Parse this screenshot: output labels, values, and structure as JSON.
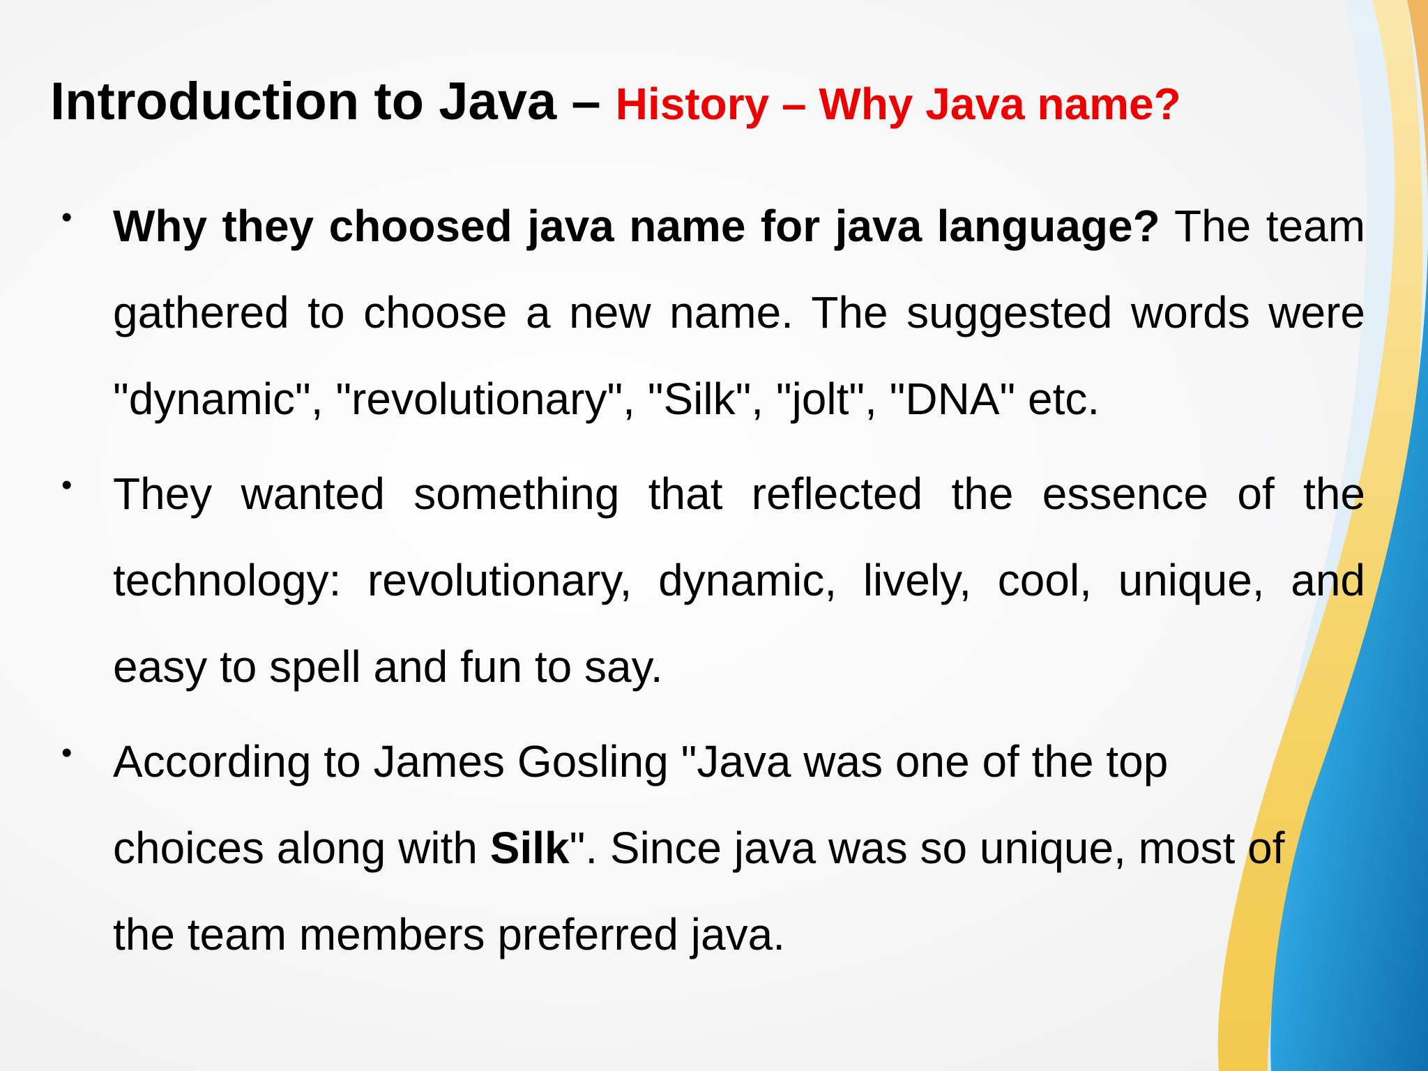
{
  "slide": {
    "title_main": "Introduction to Java – ",
    "title_sub": "History – Why Java name?",
    "bullet_symbol": "•",
    "bullets": [
      {
        "lead_bold": "Why they choosed java name for java language?",
        "text": " The team gathered to choose a new name. The suggested words were \"dynamic\", \"revolutionary\", \"Silk\", \"jolt\", \"DNA\" etc."
      },
      {
        "text": "They wanted something that reflected the essence of the technology: revolutionary, dynamic, lively, cool, unique, and easy to spell and fun to say."
      },
      {
        "line1": "According to James Gosling \"Java was one of the top",
        "line2_pre": "choices along with ",
        "line2_bold": "Silk",
        "line2_post": "\". Since java was so unique, most of",
        "line3": "the team members preferred java."
      }
    ]
  },
  "colors": {
    "title": "#000000",
    "subtitle": "#ee0000",
    "wave_blue": "#1a8ccc",
    "wave_yellow": "#f5d36a"
  }
}
